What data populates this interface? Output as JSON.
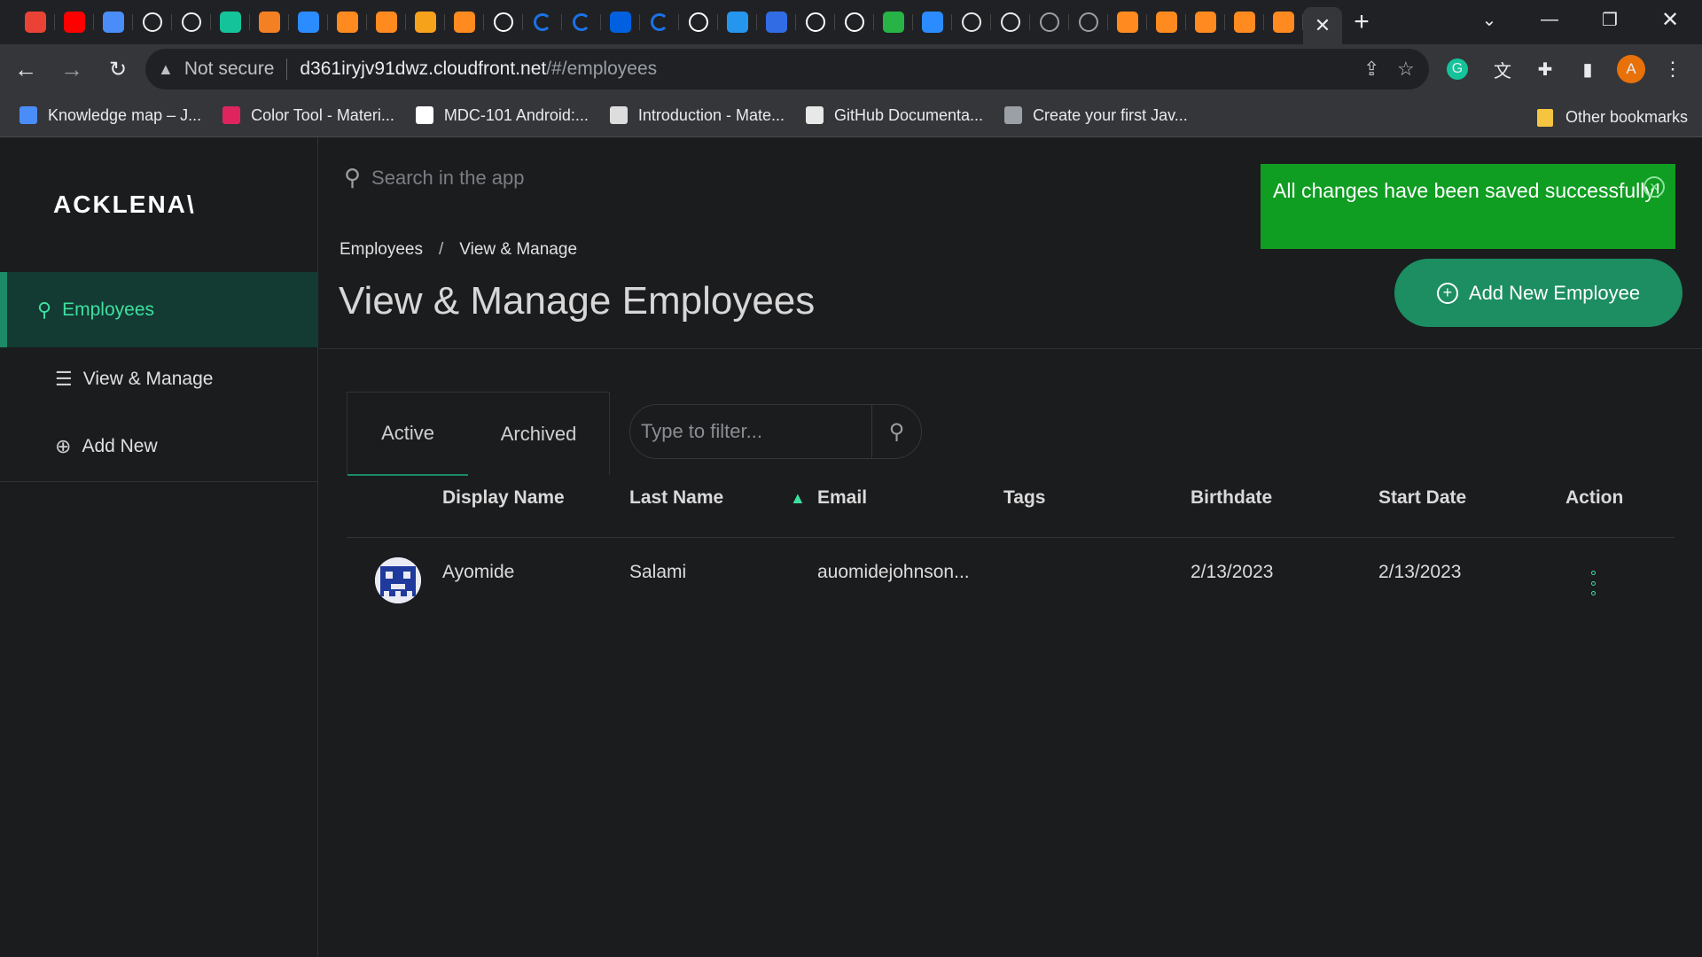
{
  "browser": {
    "tabs_favicons": [
      "gmail",
      "youtube",
      "knowledge-map",
      "github",
      "github",
      "grammarly",
      "stackoverflow",
      "webflow",
      "aws",
      "aws",
      "aws-package",
      "aws",
      "medium",
      "refresh-blue",
      "refresh-blue",
      "firefox",
      "refresh-blue",
      "medium",
      "docker",
      "kubernetes",
      "medium",
      "medium",
      "n-green",
      "webflow",
      "hashnode",
      "hashnode",
      "globe",
      "globe",
      "aws",
      "aws",
      "aws",
      "aws",
      "aws"
    ],
    "active_tab_close": "✕",
    "new_tab": "+",
    "address": {
      "security_label": "Not secure",
      "host": "d361iryjv91dwz.cloudfront.net",
      "path": "/#/employees"
    },
    "profile_initial": "A",
    "bookmarks": [
      {
        "label": "Knowledge map – J...",
        "color": "#4b8df8"
      },
      {
        "label": "Color Tool - Materi...",
        "color": "#e0245e"
      },
      {
        "label": "MDC-101 Android:...",
        "color": "#ffffff"
      },
      {
        "label": "Introduction - Mate...",
        "color": "#dddddd"
      },
      {
        "label": "GitHub Documenta...",
        "color": "#e8e8e8"
      },
      {
        "label": "Create your first Jav...",
        "color": "#9aa0a6"
      }
    ],
    "other_bookmarks": "Other bookmarks"
  },
  "app": {
    "logo": "ACKLENA\\",
    "sidebar": {
      "section": "Employees",
      "items": [
        {
          "label": "View & Manage"
        },
        {
          "label": "Add New"
        }
      ]
    },
    "search_placeholder": "Search in the app",
    "toast": {
      "message": "All changes have been saved successfully!",
      "color": "#0f9d22"
    },
    "breadcrumb": {
      "root": "Employees",
      "separator": "/",
      "current": "View & Manage"
    },
    "page_title": "View & Manage Employees",
    "add_button": "Add New Employee",
    "accent_color": "#1c8e62",
    "tabs": {
      "active": "Active",
      "archived": "Archived"
    },
    "filter_placeholder": "Type to filter...",
    "table": {
      "headers": [
        "Display Name",
        "Last Name",
        "Email",
        "Tags",
        "Birthdate",
        "Start Date",
        "Action"
      ],
      "rows": [
        {
          "display_name": "Ayomide",
          "last_name": "Salami",
          "email": "auomidejohnson...",
          "tags": "",
          "birthdate": "2/13/2023",
          "start_date": "2/13/2023"
        }
      ]
    }
  }
}
